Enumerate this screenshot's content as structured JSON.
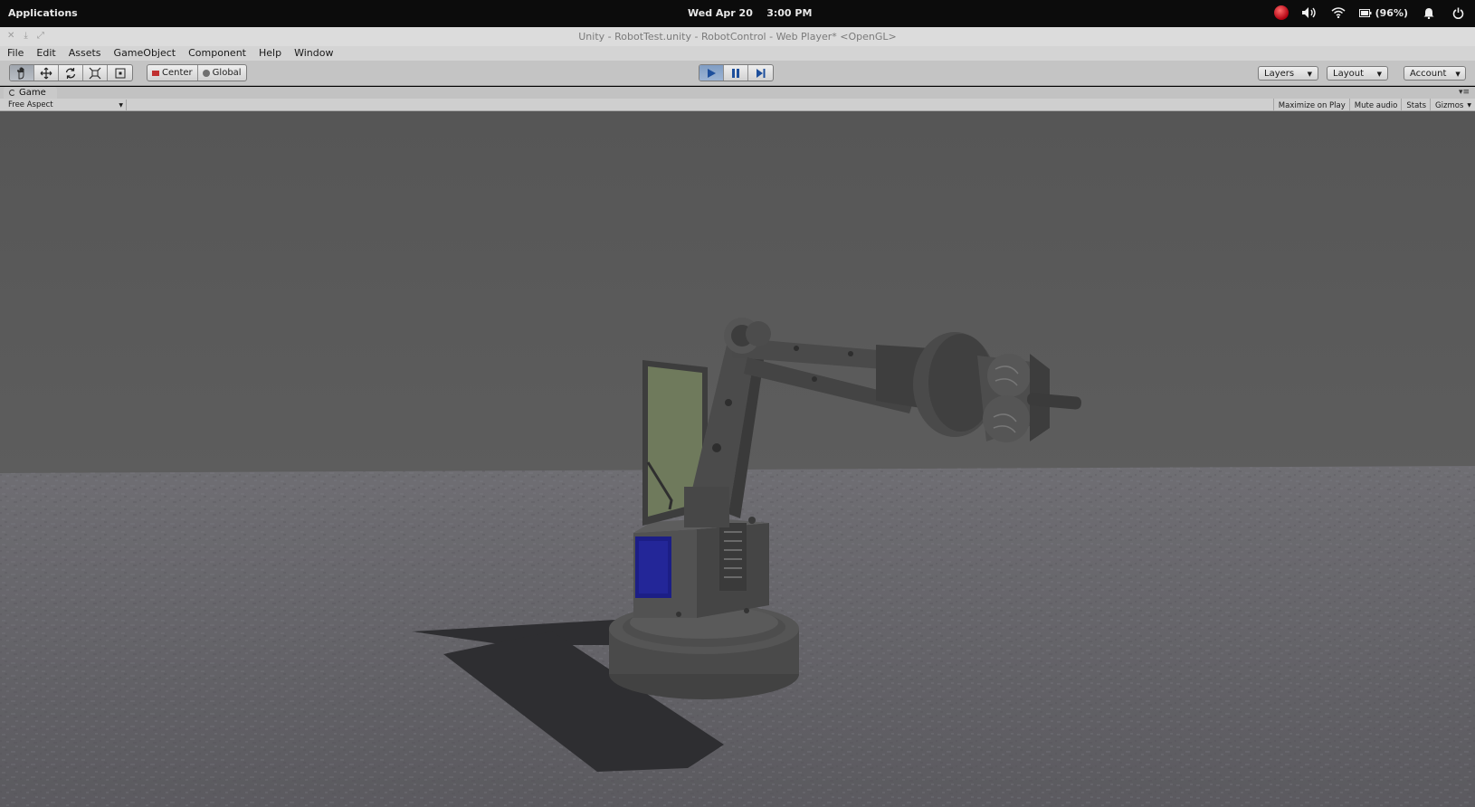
{
  "system_bar": {
    "applications": "Applications",
    "date": "Wed Apr 20",
    "time": "3:00 PM",
    "battery": "(96%)"
  },
  "window": {
    "title": "Unity - RobotTest.unity - RobotControl - Web Player* <OpenGL>"
  },
  "menu": [
    "File",
    "Edit",
    "Assets",
    "GameObject",
    "Component",
    "Help",
    "Window"
  ],
  "toolbar": {
    "pivot_label": "Center",
    "space_label": "Global",
    "layers_label": "Layers",
    "layout_label": "Layout",
    "account_label": "Account"
  },
  "game_panel": {
    "tab_label": "Game",
    "aspect": "Free Aspect",
    "maximize_on_play": "Maximize on Play",
    "mute_audio": "Mute audio",
    "stats": "Stats",
    "gizmos": "Gizmos"
  },
  "colors": {
    "sky": "#585858",
    "ground": "#6e6d73",
    "robot": "#4c4c4c",
    "screen_panel": "#6f7a5c",
    "blue_panel": "#1c1e86",
    "play_active": "#88a6cc"
  }
}
